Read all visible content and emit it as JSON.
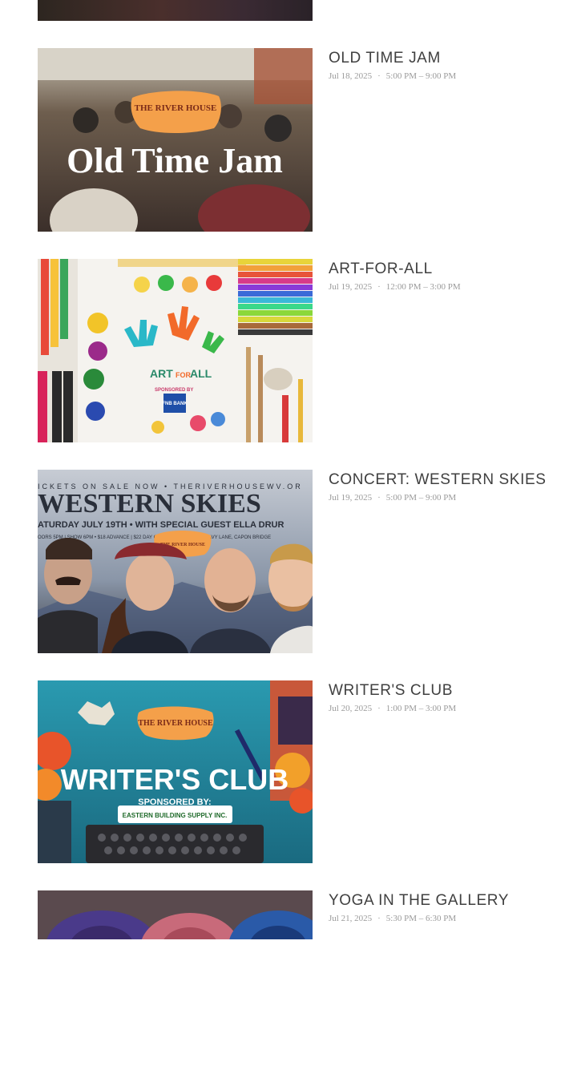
{
  "events": [
    {
      "title": "OLD TIME JAM",
      "date": "Jul 18, 2025",
      "separator": "·",
      "time": "5:00 PM – 9:00 PM",
      "image_text": "Old Time Jam",
      "image_logo": "THE RIVER HOUSE"
    },
    {
      "title": "ART-FOR-ALL",
      "date": "Jul 19, 2025",
      "separator": "·",
      "time": "12:00 PM – 3:00 PM",
      "image_text_1": "ART",
      "image_text_2": "FOR",
      "image_text_3": "ALL",
      "image_sponsor": "SPONSORED BY",
      "image_bank": "FNB BANK"
    },
    {
      "title": "CONCERT: WESTERN SKIES",
      "date": "Jul 19, 2025",
      "separator": "·",
      "time": "5:00 PM – 9:00 PM",
      "image_ticker": "ICKETS ON SALE NOW • THERIVERHOUSEWV.OR",
      "image_text": "WESTERN SKIES",
      "image_subline": "ATURDAY JULY 19TH • WITH SPECIAL GUEST ELLA DRUR",
      "image_detail": "OORS 5PM | SHOW 6PM • $18 ADVANCE | $22 DAY OF SHOW • 24 RICKIE DAVY LANE, CAPON BRIDGE",
      "image_logo": "THE RIVER HOUSE"
    },
    {
      "title": "WRITER'S CLUB",
      "date": "Jul 20, 2025",
      "separator": "·",
      "time": "1:00 PM – 3:00 PM",
      "image_text": "WRITER'S CLUB",
      "image_sponsor": "SPONSORED BY:",
      "image_company": "EASTERN BUILDING SUPPLY INC.",
      "image_logo": "THE RIVER HOUSE"
    },
    {
      "title": "YOGA IN THE GALLERY",
      "date": "Jul 21, 2025",
      "separator": "·",
      "time": "5:30 PM – 6:30 PM"
    }
  ]
}
